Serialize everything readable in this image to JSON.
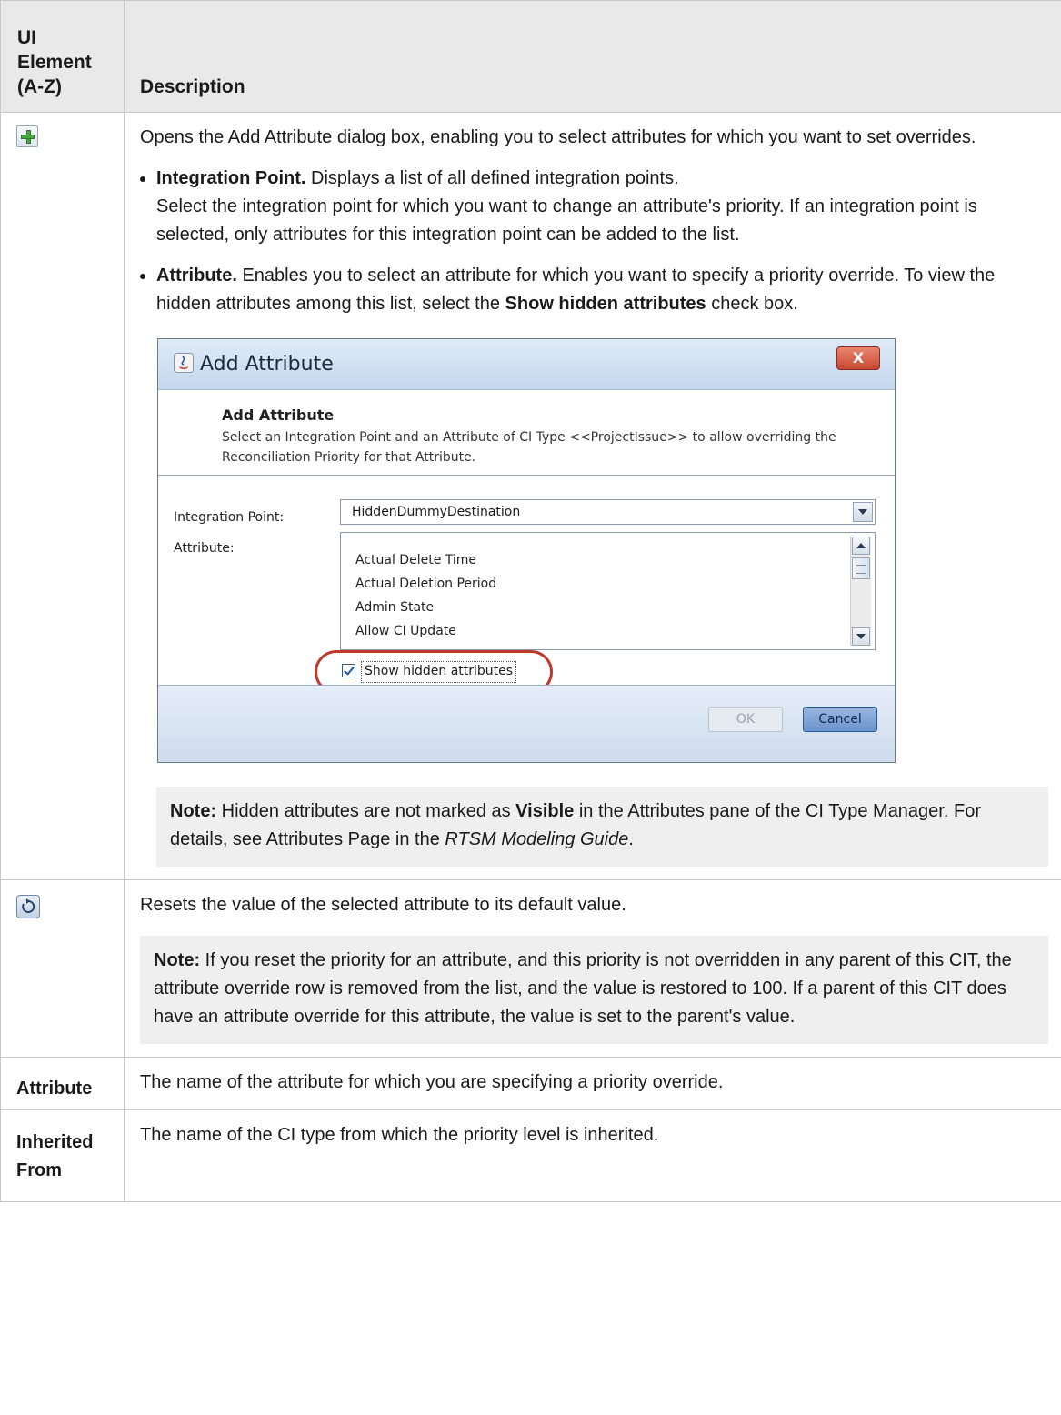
{
  "table": {
    "header": {
      "col1": "UI\nElement\n(A-Z)",
      "col2": "Description"
    }
  },
  "rows": {
    "add": {
      "icon": "add-plus-icon",
      "desc": "Opens the Add Attribute dialog box, enabling you to select attributes for which you want to set overrides.",
      "bullet1_term": "Integration Point.",
      "bullet1_text": " Displays a list of all defined integration points.",
      "bullet1_sub": "Select the integration point for which you want to change an attribute's priority. If an integration point is selected, only attributes for this integration point can be added to the list.",
      "bullet2_term": "Attribute.",
      "bullet2_text_a": " Enables you to select an attribute for which you want to specify a priority override. To view the hidden attributes among this list, select the ",
      "bullet2_bold": "Show hidden attributes",
      "bullet2_text_b": " check box.",
      "note_label": "Note:",
      "note_a": " Hidden attributes are not marked as ",
      "note_bold": "Visible",
      "note_b": " in the Attributes pane of the CI Type Manager. For details, see Attributes Page in the ",
      "note_italic": "RTSM Modeling Guide",
      "note_c": "."
    },
    "reset": {
      "icon": "reset-icon",
      "desc": "Resets the value of the selected attribute to its default value.",
      "note_label": "Note:",
      "note_text": " If you reset the priority for an attribute, and this priority is not overridden in any parent of this CIT, the attribute override row is removed from the list, and the value is restored to 100. If a parent of this CIT does have an attribute override for this attribute, the value is set to the parent's value."
    },
    "attribute": {
      "element": "Attribute",
      "desc": "The name of the attribute for which you are specifying a priority override."
    },
    "inherited": {
      "element": "Inherited\nFrom",
      "desc": "The name of the CI type from which the priority level is inherited."
    }
  },
  "dialog": {
    "title": "Add Attribute",
    "close_label": "X",
    "header_title": "Add Attribute",
    "header_desc": "Select an Integration Point and an Attribute of CI Type <<ProjectIssue>> to allow overriding the Reconciliation Priority for that Attribute.",
    "integration_point_label": "Integration Point:",
    "integration_point_value": "HiddenDummyDestination",
    "attribute_label": "Attribute:",
    "attributes": [
      "Actual Delete Time",
      "Actual Deletion Period",
      "Admin State",
      "Allow CI Update"
    ],
    "show_hidden_label": "Show hidden attributes",
    "show_hidden_checked": true,
    "ok_label": "OK",
    "cancel_label": "Cancel",
    "colors": {
      "highlight": "#c0392b",
      "title_bar": "#c5d8ee",
      "close": "#c84a33"
    }
  }
}
